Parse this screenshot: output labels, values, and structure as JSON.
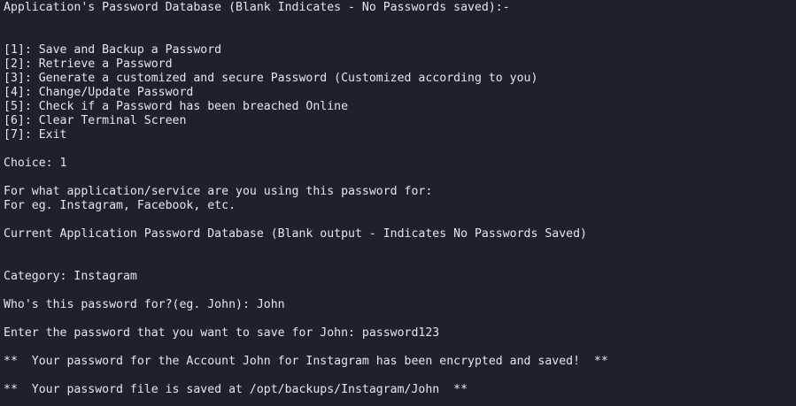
{
  "terminal": {
    "header": "Application's Password Database (Blank Indicates - No Passwords saved):-",
    "menu": [
      "[1]: Save and Backup a Password",
      "[2]: Retrieve a Password",
      "[3]: Generate a customized and secure Password (Customized according to you)",
      "[4]: Change/Update Password",
      "[5]: Check if a Password has been breached Online",
      "[6]: Clear Terminal Screen",
      "[7]: Exit"
    ],
    "choice": "Choice: 1",
    "prompt_app": "For what application/service are you using this password for:",
    "prompt_app_example": "For eg. Instagram, Facebook, etc.",
    "database_notice": "Current Application Password Database (Blank output - Indicates No Passwords Saved)",
    "category": "Category: Instagram",
    "prompt_user": "Who's this password for?(eg. John): John",
    "prompt_password": "Enter the password that you want to save for John: password123",
    "msg_encrypted": "**  Your password for the Account John for Instagram has been encrypted and saved!  **",
    "msg_saved_path": "**  Your password file is saved at /opt/backups/Instagram/John  **"
  },
  "colors": {
    "background": "#1e2129",
    "foreground": "#e6e6e6"
  }
}
